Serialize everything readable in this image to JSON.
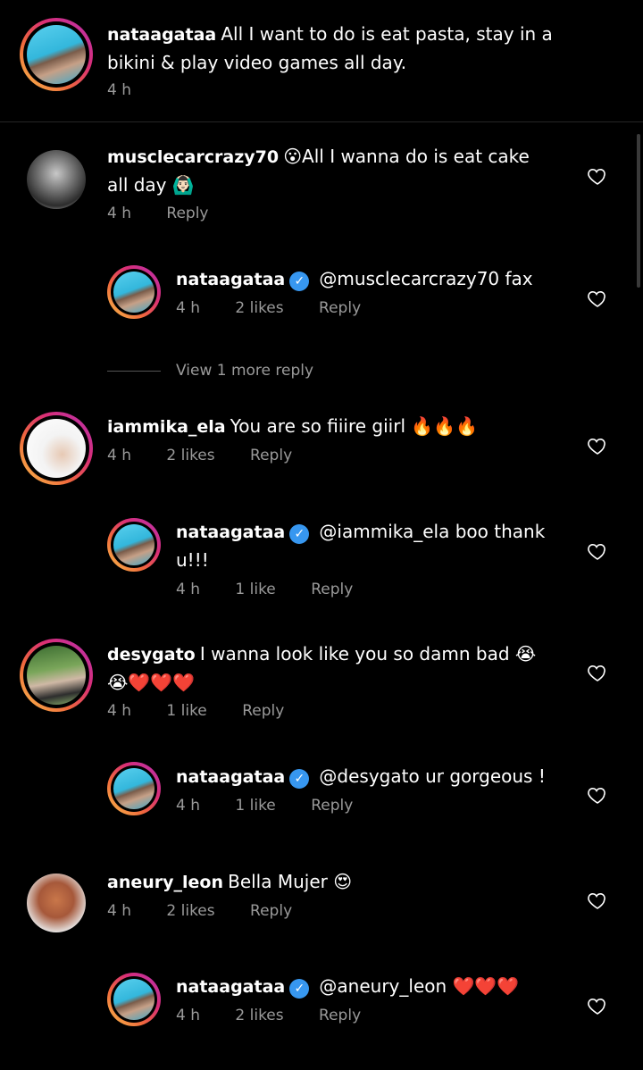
{
  "caption": {
    "username": "nataagataa",
    "text_line1": "All I want to do is eat pasta, stay in a",
    "text_line2": "bikini & play video games all day.",
    "time": "4 h"
  },
  "comments": [
    {
      "username": "musclecarcrazy70",
      "text_line1": "😮All I wanna do is eat cake",
      "text_line2": "all day 🙆🏻‍♂️",
      "time": "4 h",
      "likes": "",
      "reply_label": "Reply"
    },
    {
      "username": "nataagataa",
      "text_line1": "@musclecarcrazy70 fax",
      "time": "4 h",
      "likes": "2 likes",
      "reply_label": "Reply"
    },
    {
      "view_more": "View 1 more reply"
    },
    {
      "username": "iammika_ela",
      "text_line1": "You are so fiiire giirl 🔥🔥🔥",
      "time": "4 h",
      "likes": "2 likes",
      "reply_label": "Reply"
    },
    {
      "username": "nataagataa",
      "text_line1": "@iammika_ela boo thank",
      "text_line2": "u!!!",
      "time": "4 h",
      "likes": "1 like",
      "reply_label": "Reply"
    },
    {
      "username": "desygato",
      "text_line1": "I wanna look like you so damn bad 😭",
      "text_line2": "😭❤️❤️❤️",
      "time": "4 h",
      "likes": "1 like",
      "reply_label": "Reply"
    },
    {
      "username": "nataagataa",
      "text_line1": "@desygato ur gorgeous !",
      "time": "4 h",
      "likes": "1 like",
      "reply_label": "Reply"
    },
    {
      "username": "aneury_leon",
      "text_line1": "Bella Mujer 😍",
      "time": "4 h",
      "likes": "2 likes",
      "reply_label": "Reply"
    },
    {
      "username": "nataagataa",
      "text_line1": "@aneury_leon ❤️❤️❤️",
      "time": "4 h",
      "likes": "2 likes",
      "reply_label": "Reply"
    }
  ],
  "icons": {
    "like": "heart-outline-icon",
    "verified": "verified-badge-icon"
  },
  "colors": {
    "background": "#000000",
    "meta_text": "#9a9a9a",
    "verified_blue": "#3797f0"
  }
}
